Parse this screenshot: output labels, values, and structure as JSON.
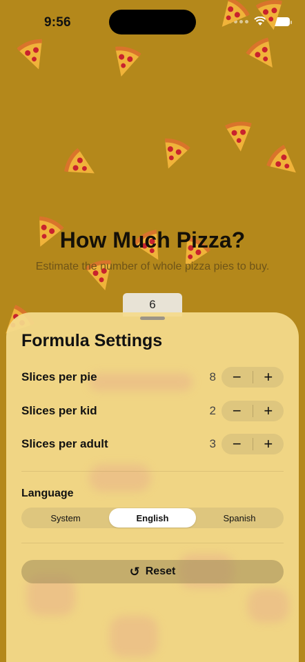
{
  "status_bar": {
    "time": "9:56"
  },
  "main": {
    "title": "How Much Pizza?",
    "subtitle": "Estimate the number of whole pizza pies to buy.",
    "result": "6"
  },
  "settings": {
    "title": "Formula Settings",
    "rows": [
      {
        "label": "Slices per pie",
        "value": "8"
      },
      {
        "label": "Slices per kid",
        "value": "2"
      },
      {
        "label": "Slices per adult",
        "value": "3"
      }
    ],
    "minus_label": "−",
    "plus_label": "+",
    "language_label": "Language",
    "language_options": [
      "System",
      "English",
      "Spanish"
    ],
    "language_selected": "English",
    "reset_label": "Reset"
  },
  "icons": {
    "reset": "arrow-counterclockwise-icon",
    "slice": "pizza-slice-icon"
  },
  "colors": {
    "background": "#b4881b",
    "sheet": "#f4da8c",
    "pizza_crust": "#d9742b",
    "pepperoni": "#c8232d"
  }
}
